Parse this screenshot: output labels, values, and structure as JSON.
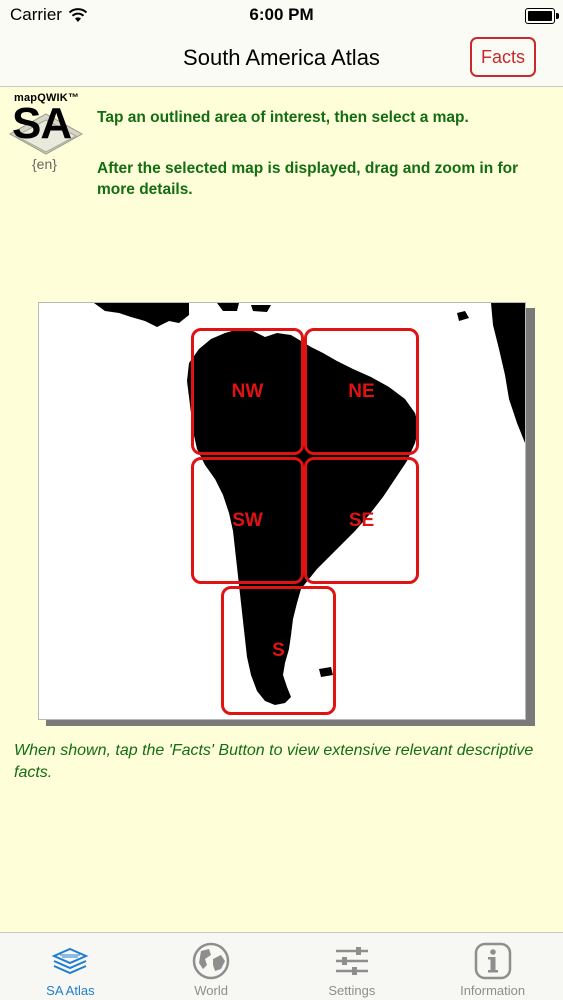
{
  "status_bar": {
    "carrier": "Carrier",
    "time": "6:00 PM"
  },
  "nav": {
    "title": "South America Atlas",
    "facts_label": "Facts"
  },
  "logo": {
    "brand": "mapQWIK™",
    "code": "SA",
    "lang": "{en}"
  },
  "instructions": {
    "line1": "Tap an outlined area of interest, then select a map.",
    "line2": "After the selected map is displayed, drag and zoom in for more details."
  },
  "map": {
    "regions": [
      {
        "label": "NW"
      },
      {
        "label": "NE"
      },
      {
        "label": "SW"
      },
      {
        "label": "SE"
      },
      {
        "label": "S"
      }
    ],
    "outline_color": "#e11212"
  },
  "footer_note": "When shown, tap the 'Facts' Button to view extensive relevant descriptive facts.",
  "tabs": [
    {
      "label": "SA Atlas",
      "icon": "layers-icon",
      "active": true
    },
    {
      "label": "World",
      "icon": "globe-icon",
      "active": false
    },
    {
      "label": "Settings",
      "icon": "sliders-icon",
      "active": false
    },
    {
      "label": "Information",
      "icon": "info-icon",
      "active": false
    }
  ],
  "colors": {
    "accent": "#c8282e",
    "instruction_text": "#136d13",
    "tab_active": "#1f7ecf",
    "background": "#fefed8"
  }
}
